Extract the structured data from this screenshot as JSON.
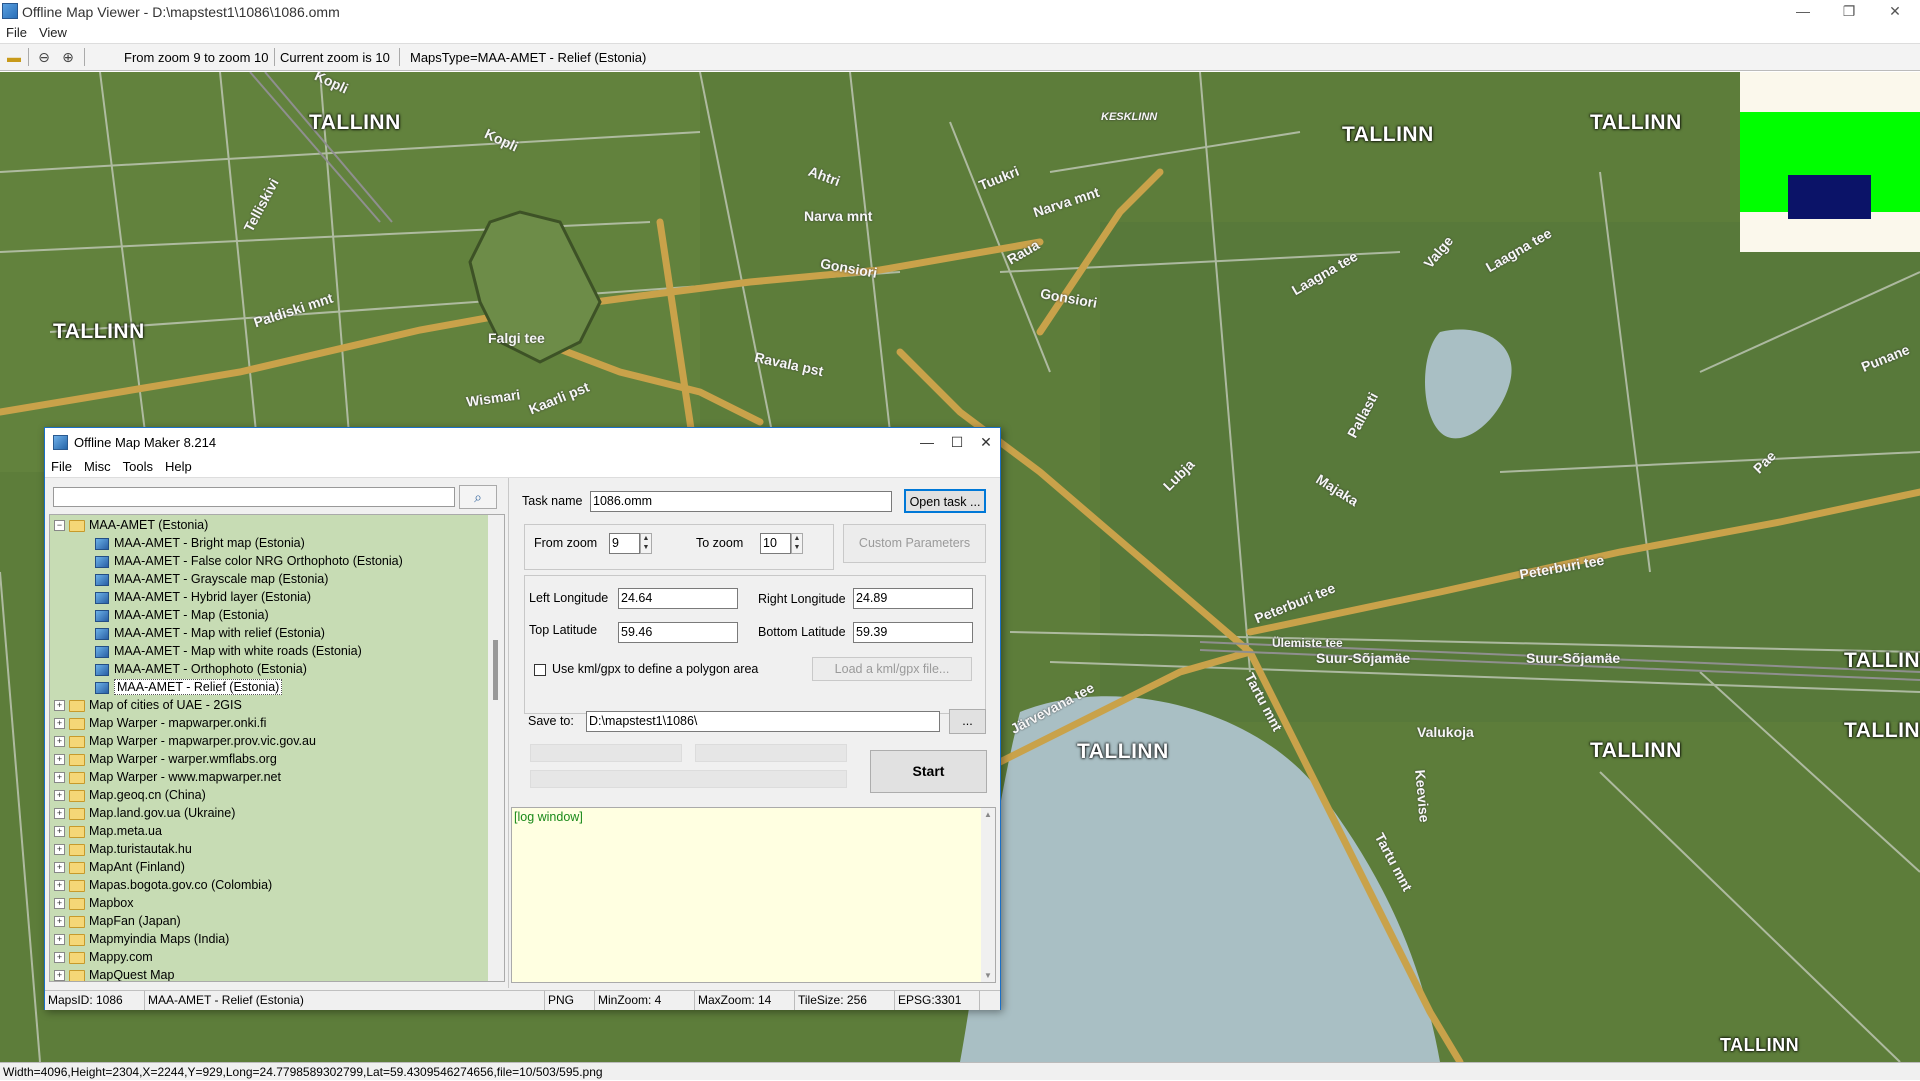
{
  "viewer": {
    "title": "Offline Map Viewer - D:\\mapstest1\\1086\\1086.omm",
    "menu": [
      "File",
      "View"
    ],
    "toolbar": {
      "zoom_range": "From zoom 9 to zoom 10",
      "current_zoom": "Current zoom is 10",
      "maps_type": "MapsType=MAA-AMET - Relief (Estonia)"
    },
    "status": "Width=4096,Height=2304,X=2244,Y=929,Long=24.7798589302799,Lat=59.4309546274656,file=10/503/595.png"
  },
  "map": {
    "city_labels": [
      "TALLINN",
      "TALLINN",
      "TALLINN",
      "TALLINN",
      "TALLINN",
      "TALLINN",
      "TALLINN",
      "TALLINN",
      "TALLINN"
    ],
    "streets": [
      "Kopli",
      "Kopli",
      "Telliskivi",
      "Paldiski mnt",
      "Narva mnt",
      "Narva mnt",
      "Gonsiori",
      "Gonsiori",
      "Laagna tee",
      "Laagna tee",
      "Peterburi tee",
      "Peterburi tee",
      "Tartu mnt",
      "Tartu mnt",
      "Suur-Sõjamäe",
      "Suur-Sõjamäe",
      "Valukoja",
      "Ülemiste tee",
      "KESKLINN",
      "Raua",
      "Tuukri",
      "Ahtri",
      "Ravala pst",
      "Kaarli pst",
      "Wismari",
      "Falgi tee",
      "Punane",
      "Majaka",
      "Lubja",
      "Pallasti",
      "Keevise",
      "Järvevana tee",
      "Valge",
      "Pae"
    ]
  },
  "dialog": {
    "title": "Offline Map Maker 8.214",
    "menu": [
      "File",
      "Misc",
      "Tools",
      "Help"
    ],
    "search_value": "",
    "tree": {
      "root": "MAA-AMET (Estonia)",
      "children": [
        "MAA-AMET - Bright map (Estonia)",
        "MAA-AMET - False color NRG Orthophoto (Estonia)",
        "MAA-AMET - Grayscale map (Estonia)",
        "MAA-AMET - Hybrid layer (Estonia)",
        "MAA-AMET - Map (Estonia)",
        "MAA-AMET - Map with relief (Estonia)",
        "MAA-AMET - Map with white roads (Estonia)",
        "MAA-AMET - Orthophoto (Estonia)",
        "MAA-AMET - Relief (Estonia)"
      ],
      "folders": [
        "Map of cities of UAE - 2GIS",
        "Map Warper - mapwarper.onki.fi",
        "Map Warper - mapwarper.prov.vic.gov.au",
        "Map Warper - warper.wmflabs.org",
        "Map Warper - www.mapwarper.net",
        "Map.geoq.cn (China)",
        "Map.land.gov.ua (Ukraine)",
        "Map.meta.ua",
        "Map.turistautak.hu",
        "MapAnt (Finland)",
        "Mapas.bogota.gov.co (Colombia)",
        "Mapbox",
        "MapFan (Japan)",
        "Mapmyindia Maps (India)",
        "Mappy.com",
        "MapQuest Map"
      ]
    },
    "task_name_label": "Task name",
    "task_name_value": "1086.omm",
    "open_task_label": "Open task ...",
    "from_zoom_label": "From zoom",
    "from_zoom_value": "9",
    "to_zoom_label": "To zoom",
    "to_zoom_value": "10",
    "custom_params_label": "Custom Parameters",
    "left_lon_label": "Left Longitude",
    "left_lon_value": "24.64",
    "right_lon_label": "Right Longitude",
    "right_lon_value": "24.89",
    "top_lat_label": "Top Latitude",
    "top_lat_value": "59.46",
    "bottom_lat_label": "Bottom Latitude",
    "bottom_lat_value": "59.39",
    "kml_label": "Use kml/gpx to define a polygon area",
    "load_kml_label": "Load a kml/gpx file...",
    "save_to_label": "Save to:",
    "save_to_value": "D:\\mapstest1\\1086\\",
    "browse_label": "...",
    "start_label": "Start",
    "log_text": "[log window]",
    "status": {
      "maps_id": "MapsID: 1086",
      "map_name": "MAA-AMET - Relief (Estonia)",
      "format": "PNG",
      "min_zoom": "MinZoom: 4",
      "max_zoom": "MaxZoom: 14",
      "tile_size": "TileSize: 256",
      "epsg": "EPSG:3301"
    }
  },
  "colors": {
    "map_bg": "#5d7d3a",
    "water": "#a9bfc4",
    "road_major": "#c9a24a",
    "tree_bg": "#c7dcb4",
    "log_bg": "#ffffe1",
    "legend_green": "#00ff00",
    "legend_navy": "#0b1368"
  }
}
